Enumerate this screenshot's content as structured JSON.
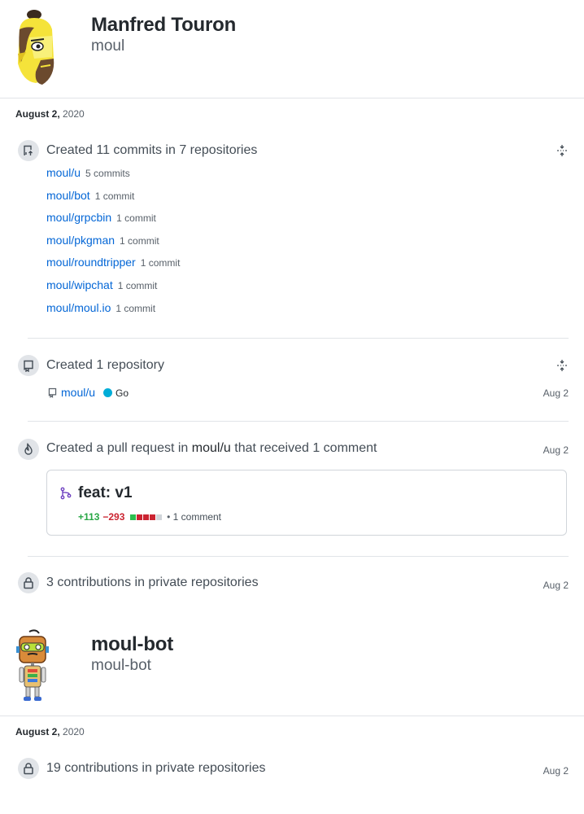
{
  "profiles": [
    {
      "name": "Manfred Touron",
      "login": "moul",
      "date_month_day": "August 2,",
      "date_year": "2020"
    },
    {
      "name": "moul-bot",
      "login": "moul-bot",
      "date_month_day": "August 2,",
      "date_year": "2020"
    }
  ],
  "commits": {
    "title": "Created 11 commits in 7 repositories",
    "repos": [
      {
        "name": "moul/u",
        "count": "5 commits"
      },
      {
        "name": "moul/bot",
        "count": "1 commit"
      },
      {
        "name": "moul/grpcbin",
        "count": "1 commit"
      },
      {
        "name": "moul/pkgman",
        "count": "1 commit"
      },
      {
        "name": "moul/roundtripper",
        "count": "1 commit"
      },
      {
        "name": "moul/wipchat",
        "count": "1 commit"
      },
      {
        "name": "moul/moul.io",
        "count": "1 commit"
      }
    ]
  },
  "repository": {
    "title": "Created 1 repository",
    "repo_name": "moul/u",
    "language": "Go",
    "language_color": "#00add8",
    "date": "Aug 2"
  },
  "pull_request": {
    "title_prefix": "Created a pull request in",
    "repo": "moul/u",
    "title_suffix": "that received 1 comment",
    "date": "Aug 2",
    "pr_title": "feat: v1",
    "additions": "+113",
    "deletions": "−293",
    "diffstat": [
      "green",
      "red",
      "red",
      "red",
      "grey"
    ],
    "separator": "•",
    "comments": "1 comment"
  },
  "private_1": {
    "title": "3 contributions in private repositories",
    "date": "Aug 2"
  },
  "private_2": {
    "title": "19 contributions in private repositories",
    "date": "Aug 2"
  },
  "colors": {
    "link": "#0366d6",
    "add": "#28a745",
    "del": "#cb2431",
    "pr_icon": "#6f42c1"
  }
}
